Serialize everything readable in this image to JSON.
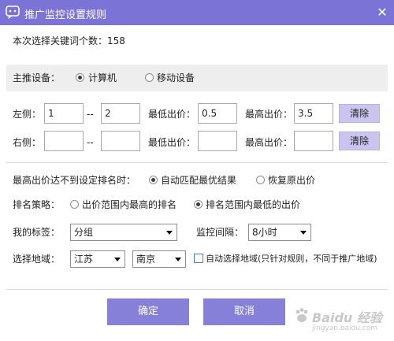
{
  "window": {
    "title": "推广监控设置规则",
    "close_glyph": "✕",
    "title_bar_color": "#7b73d6",
    "app_icon": "chat-bubble-icon"
  },
  "keyword_count_text": "本次选择关键词个数：158",
  "device": {
    "label": "主推设备：",
    "options": [
      "计算机",
      "移动设备"
    ],
    "selected": "计算机"
  },
  "left_row": {
    "label": "左侧：",
    "range_from": "1",
    "separator": "--",
    "range_to": "2",
    "min_price_label": "最低出价：",
    "min_price": "0.5",
    "max_price_label": "最高出价：",
    "max_price": "3.5",
    "clear_label": "清除"
  },
  "right_row": {
    "label": "右侧：",
    "range_from": "",
    "separator": "--",
    "range_to": "",
    "min_price_label": "最低出价：",
    "min_price": "",
    "max_price_label": "最高出价：",
    "max_price": "",
    "clear_label": "清除"
  },
  "fallback": {
    "label": "最高出价达不到设定排名时：",
    "options": [
      "自动匹配最优结果",
      "恢复原出价"
    ],
    "selected": "自动匹配最优结果"
  },
  "strategy": {
    "label": "排名策略：",
    "options": [
      "出价范围内最高的排名",
      "排名范围内最低的出价"
    ],
    "selected": "排名范围内最低的出价"
  },
  "tag": {
    "label": "我的标签：",
    "value": "分组"
  },
  "interval": {
    "label": "监控间隔：",
    "value": "8小时"
  },
  "region": {
    "label": "选择地域：",
    "province": "江苏",
    "city": "南京",
    "auto_checkbox_label": "自动选择地域(只针对规则，不同于推广地域)",
    "auto_checked": false
  },
  "buttons": {
    "confirm": "确定",
    "cancel": "取消"
  },
  "watermark": {
    "text": "Baidu 经验",
    "url": "jingyan.baidu.com"
  },
  "colors": {
    "primary_button": "#8680d9",
    "clear_button": "#c9c5ee",
    "band": "#eeeeee"
  }
}
